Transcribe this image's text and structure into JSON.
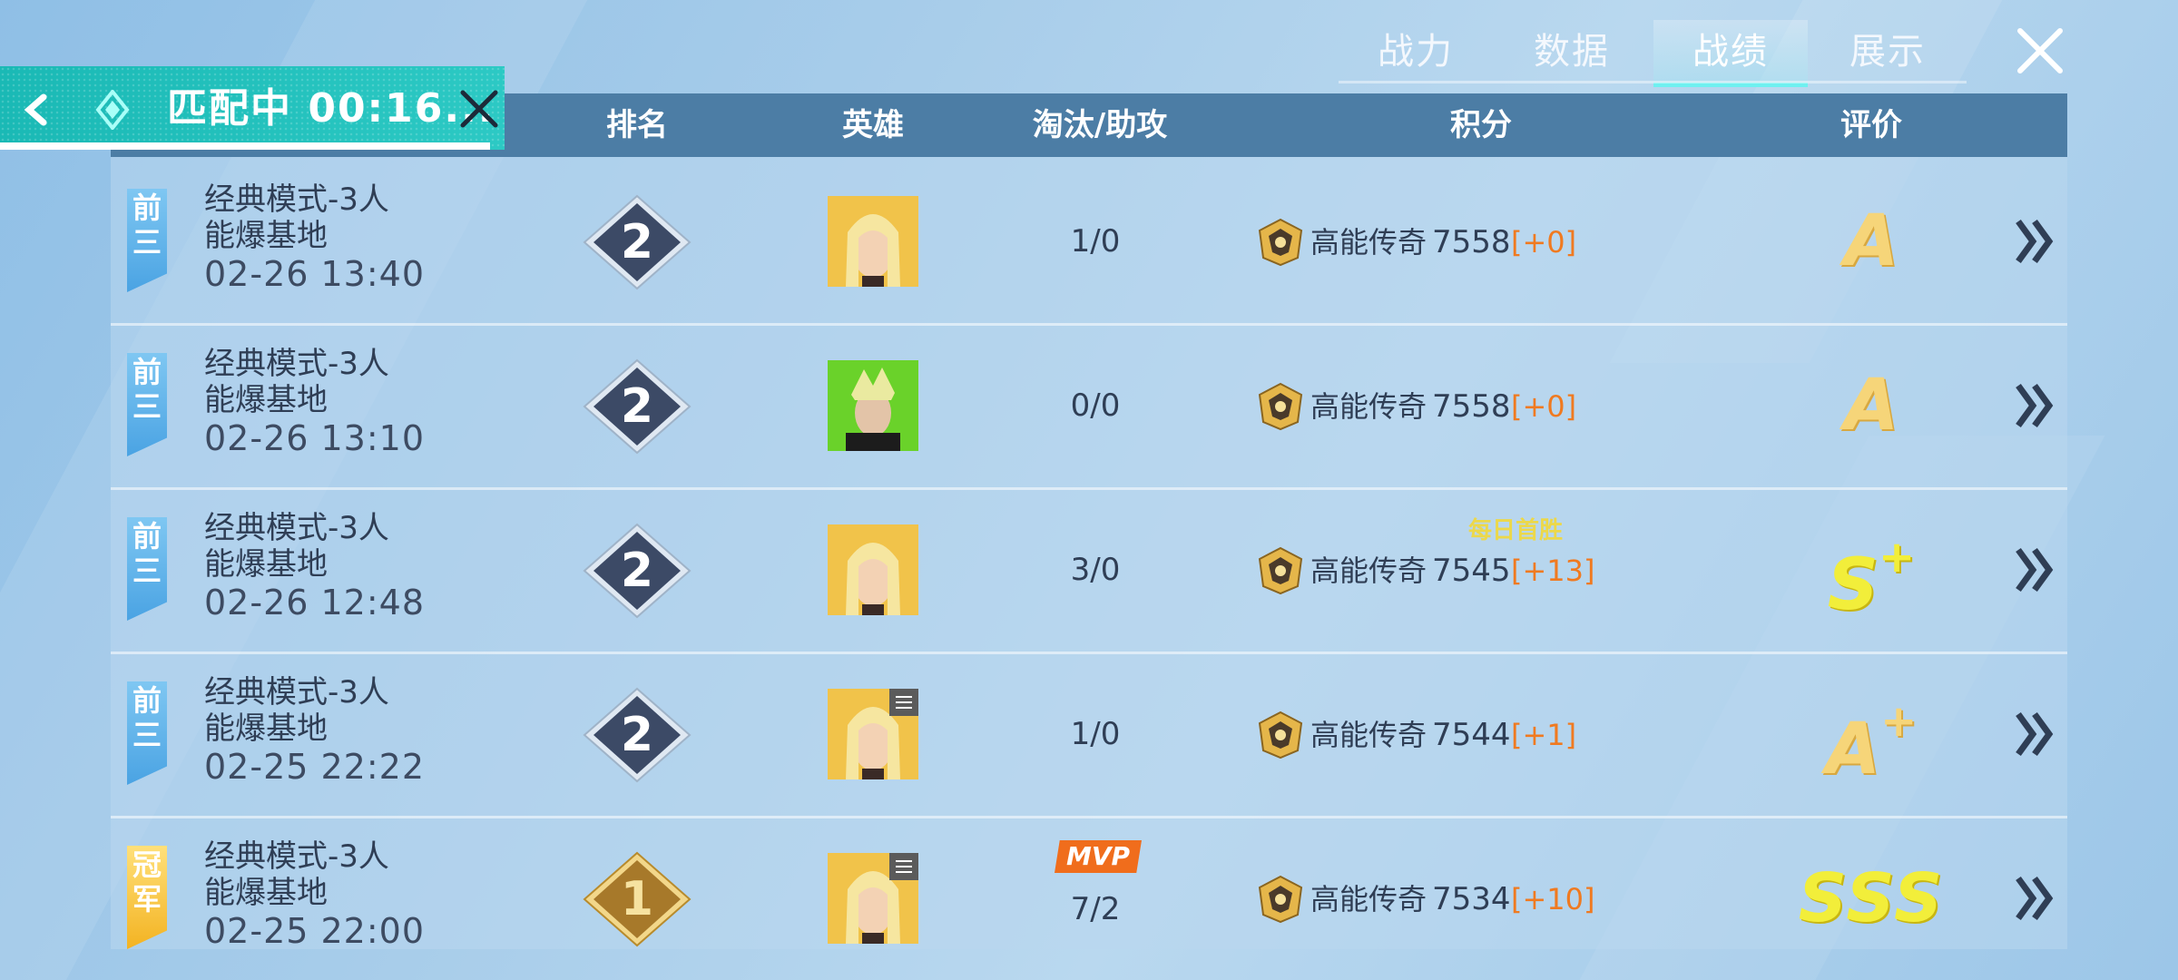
{
  "tabs": [
    {
      "label": "战力"
    },
    {
      "label": "数据"
    },
    {
      "label": "战绩"
    },
    {
      "label": "展示"
    }
  ],
  "active_tab": "战绩",
  "matching": {
    "label": "匹配中",
    "timer": "00:16..."
  },
  "table_headers": {
    "rank": "排名",
    "hero": "英雄",
    "kda": "淘汰/助攻",
    "score": "积分",
    "rating": "评价"
  },
  "rows": [
    {
      "tag": "前三",
      "mode": "经典模式-3人",
      "map": "能爆基地",
      "date": "02-26 13:40",
      "rank": "2",
      "hero": "blonde-hero",
      "kda": "1/0",
      "tier": "高能传奇",
      "score": "7558",
      "delta": "[+0]",
      "grade": "A"
    },
    {
      "tag": "前三",
      "mode": "经典模式-3人",
      "map": "能爆基地",
      "date": "02-26 13:10",
      "rank": "2",
      "hero": "green-hero",
      "kda": "0/0",
      "tier": "高能传奇",
      "score": "7558",
      "delta": "[+0]",
      "grade": "A"
    },
    {
      "tag": "前三",
      "mode": "经典模式-3人",
      "map": "能爆基地",
      "date": "02-26 12:48",
      "rank": "2",
      "hero": "blonde-hero",
      "kda": "3/0",
      "tier": "高能传奇",
      "score": "7545",
      "delta": "[+13]",
      "grade": "S+",
      "note": "每日首胜"
    },
    {
      "tag": "前三",
      "mode": "经典模式-3人",
      "map": "能爆基地",
      "date": "02-25 22:22",
      "rank": "2",
      "hero": "blonde-hero",
      "kda": "1/0",
      "tier": "高能传奇",
      "score": "7544",
      "delta": "[+1]",
      "grade": "A+"
    },
    {
      "tag": "冠军",
      "mode": "经典模式-3人",
      "map": "能爆基地",
      "date": "02-25 22:00",
      "rank": "1",
      "hero": "blonde-hero",
      "kda": "7/2",
      "tier": "高能传奇",
      "score": "7534",
      "delta": "[+10]",
      "grade": "SSS",
      "mvp": "MVP"
    }
  ],
  "colors": {
    "accent": "#2cc9c4",
    "header": "#4c7da5",
    "delta": "#f07a20",
    "grade_a": "#f6d579",
    "grade_s": "#f2ee3a"
  }
}
